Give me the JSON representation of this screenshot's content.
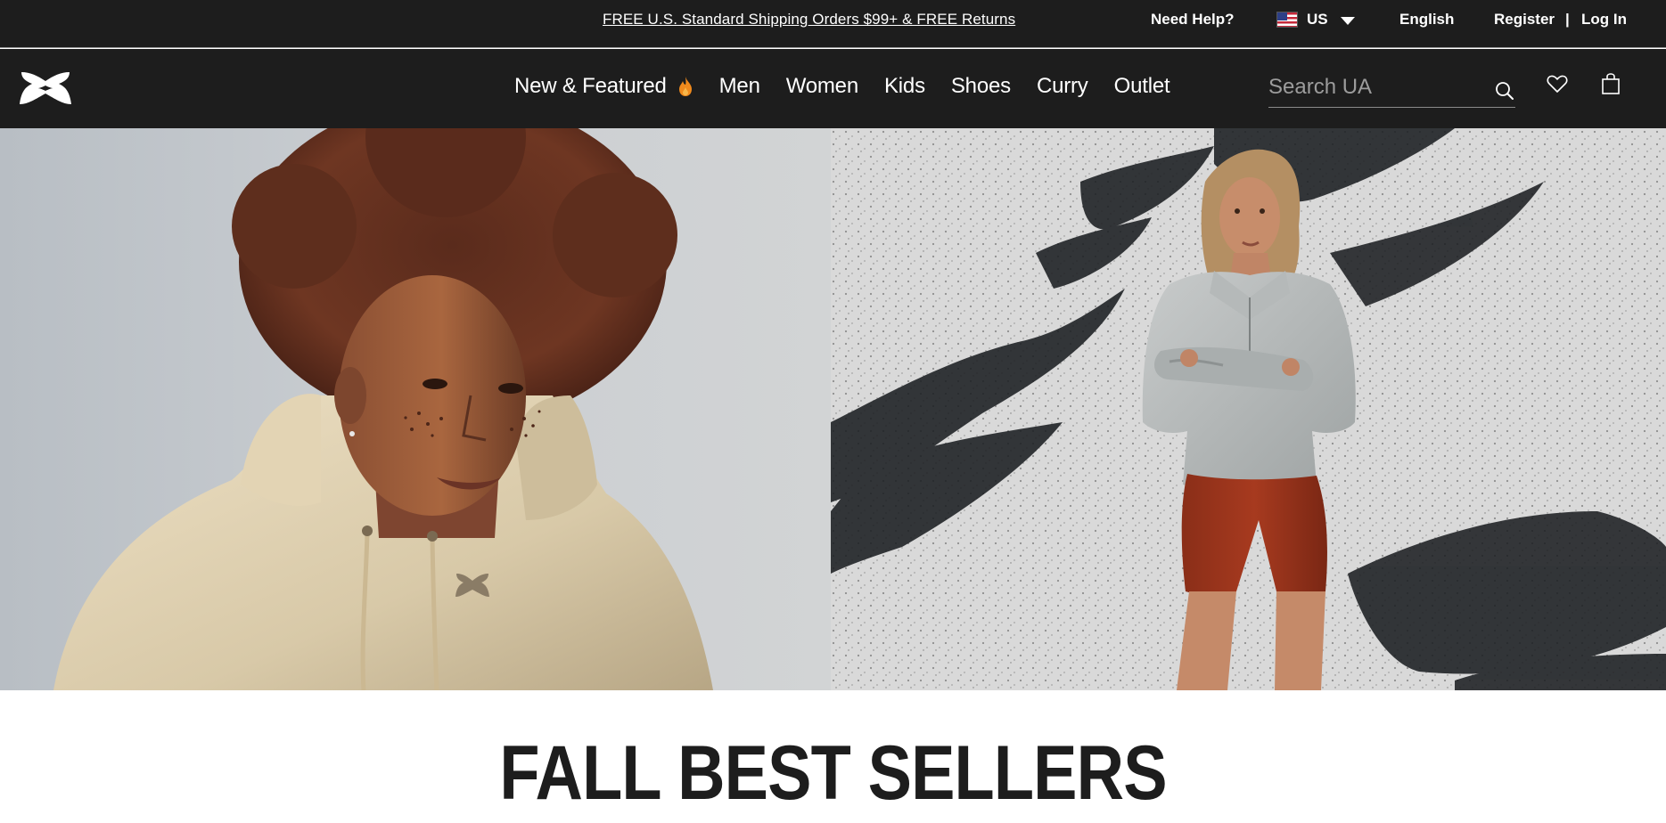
{
  "utility": {
    "promo": "FREE U.S. Standard Shipping Orders $99+ & FREE Returns",
    "help": "Need Help?",
    "country": "US",
    "language": "English",
    "register": "Register",
    "separator": "|",
    "login": "Log In"
  },
  "header": {
    "nav": [
      {
        "label": "New & Featured",
        "icon": "flame-icon"
      },
      {
        "label": "Men"
      },
      {
        "label": "Women"
      },
      {
        "label": "Kids"
      },
      {
        "label": "Shoes"
      },
      {
        "label": "Curry"
      },
      {
        "label": "Outlet"
      }
    ],
    "search_placeholder": "Search UA"
  },
  "hero": {
    "left": "hero-image-men-hoodie",
    "right": "hero-image-women-quarter-zip"
  },
  "section": {
    "title": "FALL BEST SELLERS"
  },
  "colors": {
    "header_bg": "#1d1d1d",
    "text_light": "#ffffff",
    "flame": "#f08a1c"
  }
}
